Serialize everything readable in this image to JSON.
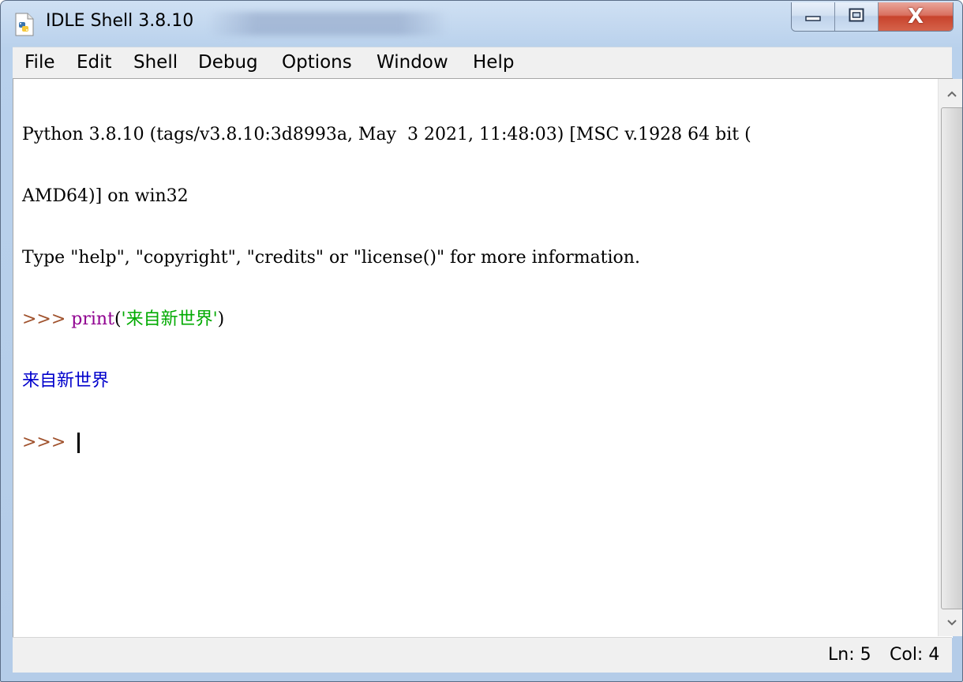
{
  "window": {
    "title": "IDLE Shell 3.8.10",
    "icon": "python-idle-icon"
  },
  "caption_buttons": {
    "minimize_icon": "minimize-icon",
    "maximize_icon": "maximize-icon",
    "close_label": "X"
  },
  "menu": {
    "items": [
      "File",
      "Edit",
      "Shell",
      "Debug",
      "Options",
      "Window",
      "Help"
    ]
  },
  "shell": {
    "lines": [
      "Python 3.8.10 (tags/v3.8.10:3d8993a, May  3 2021, 11:48:03) [MSC v.1928 64 bit (",
      "AMD64)] on win32",
      "Type \"help\", \"copyright\", \"credits\" or \"license()\" for more information."
    ],
    "prompt": ">>> ",
    "command_builtin": "print",
    "command_open": "(",
    "command_string": "'来自新世界'",
    "command_close": ")",
    "output": "来自新世界",
    "colors": {
      "prompt": "#a0522d",
      "builtin": "#900090",
      "string": "#00aa00",
      "stdout": "#0000cc"
    }
  },
  "status": {
    "ln": "Ln: 5",
    "col": "Col: 4"
  }
}
